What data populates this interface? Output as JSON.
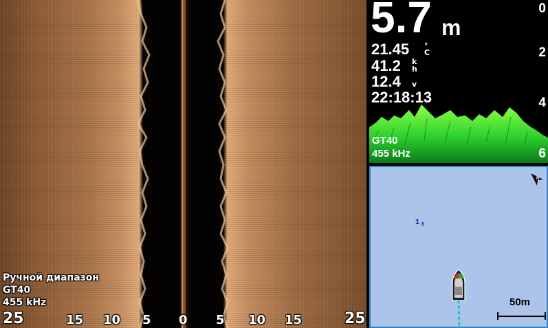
{
  "sidevu": {
    "mode_label": "Ручной диапазон",
    "transducer": "GT40",
    "frequency": "455 kHz",
    "range_scale": [
      "25",
      "15",
      "10",
      "5",
      "0",
      "5",
      "10",
      "15",
      "25"
    ]
  },
  "sonar": {
    "depth_value": "5.7",
    "depth_unit": "m",
    "water_temp": "21.45",
    "water_temp_unit_top": "°",
    "water_temp_unit_bottom": "C",
    "speed": "41.2",
    "speed_unit_top": "k",
    "speed_unit_bottom": "h",
    "voltage": "12.4",
    "voltage_unit": "v",
    "time": "22:18:13",
    "transducer": "GT40",
    "frequency": "455 kHz",
    "depth_scale": [
      "0",
      "2",
      "4",
      "6"
    ],
    "colors": {
      "return_bright": "#7dff3a",
      "return_dark": "#0a8a1e"
    }
  },
  "map": {
    "depth_sounding_value": "1",
    "depth_sounding_decimal": "6",
    "scale_label": "50m",
    "colors": {
      "water": "#acc4ea",
      "border": "#2a88c8",
      "track": "#2fd6e8"
    }
  }
}
